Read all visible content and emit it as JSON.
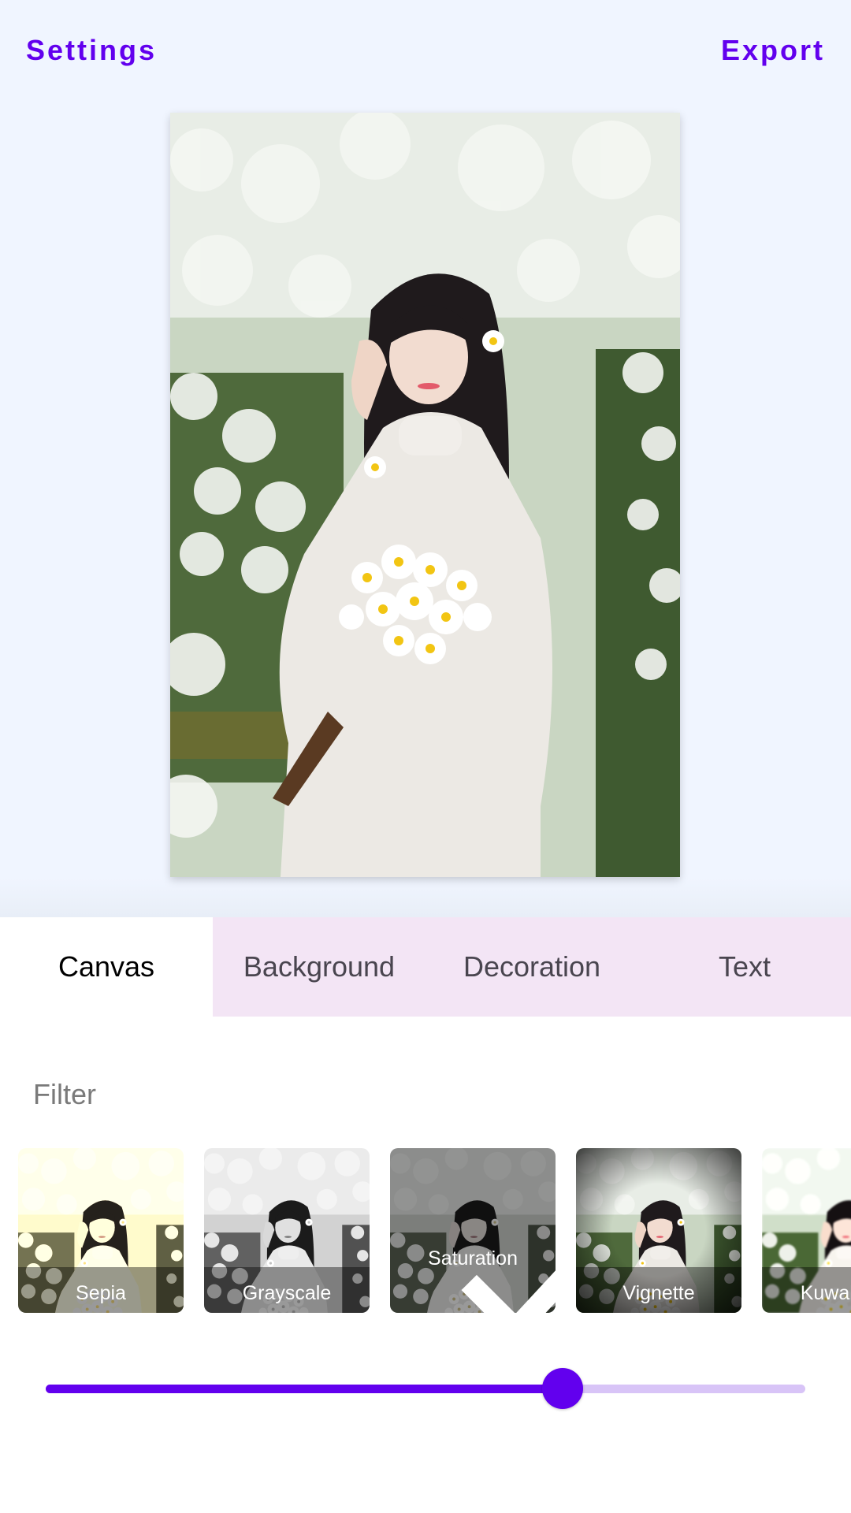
{
  "header": {
    "left_button": "Settings",
    "right_button": "Export"
  },
  "photo": {
    "description": "Woman in white turtleneck holding a bouquet of white daisies in a daisy field"
  },
  "tabs": [
    {
      "label": "Canvas",
      "active": true
    },
    {
      "label": "Background",
      "active": false
    },
    {
      "label": "Decoration",
      "active": false
    },
    {
      "label": "Text",
      "active": false
    }
  ],
  "filter": {
    "section_label": "Filter",
    "items": [
      {
        "label": "Sepia",
        "selected": false
      },
      {
        "label": "Grayscale",
        "selected": false
      },
      {
        "label": "Saturation",
        "selected": true
      },
      {
        "label": "Vignette",
        "selected": false
      },
      {
        "label": "Kuwahara",
        "selected": false
      }
    ]
  },
  "slider": {
    "value_fraction": 0.68
  },
  "colors": {
    "accent": "#6200ee",
    "accent_light": "#d8c4f7",
    "tab_bar_bg": "#f3e5f5",
    "top_bg": "#f0f5ff"
  }
}
